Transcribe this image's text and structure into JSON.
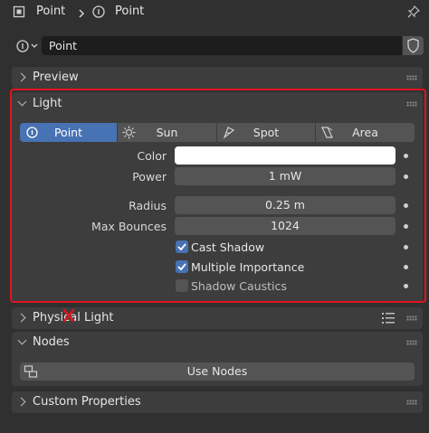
{
  "header": {
    "object_name": "Point",
    "data_name": "Point"
  },
  "datablock": {
    "name": "Point"
  },
  "panels": {
    "preview": "Preview",
    "light": "Light",
    "physical_light": "Physical Light",
    "nodes": "Nodes",
    "custom_properties": "Custom Properties"
  },
  "light_types": [
    "Point",
    "Sun",
    "Spot",
    "Area"
  ],
  "selected_light_type": "Point",
  "properties": {
    "color_label": "Color",
    "color_value": "#ffffff",
    "power_label": "Power",
    "power_value": "1 mW",
    "radius_label": "Radius",
    "radius_value": "0.25 m",
    "max_bounces_label": "Max Bounces",
    "max_bounces_value": "1024"
  },
  "checkboxes": [
    {
      "label": "Cast Shadow",
      "checked": true
    },
    {
      "label": "Multiple Importance",
      "checked": true
    },
    {
      "label": "Shadow Caustics",
      "checked": false
    }
  ],
  "use_nodes_label": "Use Nodes",
  "colors": {
    "accent": "#4772b3",
    "highlight_border": "#e0141e"
  }
}
